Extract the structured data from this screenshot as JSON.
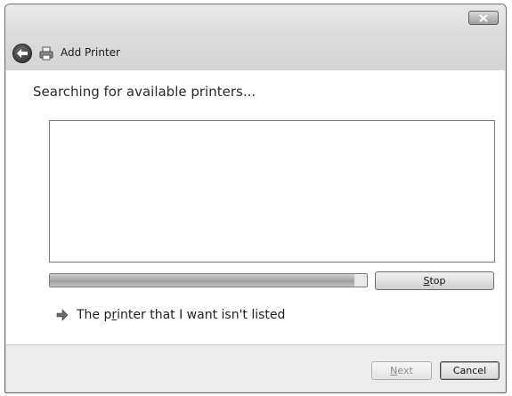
{
  "window": {
    "title": "Add Printer",
    "close_icon": "close-icon",
    "back_icon": "back-arrow-icon",
    "title_icon": "printer-icon"
  },
  "main": {
    "heading": "Searching for available printers...",
    "printer_list": [],
    "progress": {
      "fraction": 0.96
    },
    "stop_button": {
      "label": "Stop",
      "access_key": "S"
    },
    "not_listed_link": {
      "label": "The printer that I want isn't listed",
      "access_key": "r",
      "icon": "blue-arrow-icon"
    }
  },
  "footer": {
    "next_button": {
      "label": "Next",
      "access_key": "N",
      "enabled": false
    },
    "cancel_button": {
      "label": "Cancel"
    }
  }
}
